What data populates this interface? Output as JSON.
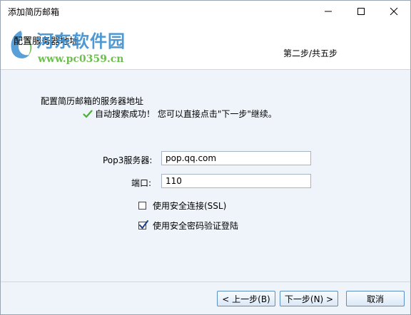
{
  "window": {
    "title": "添加简历邮箱"
  },
  "header": {
    "subtitle": "配置服务器地址",
    "step": "第二步/共五步"
  },
  "watermark": {
    "name": "河东软件园",
    "url": "www.pc0359.cn"
  },
  "main": {
    "heading": "配置简历邮箱的服务器地址",
    "success": "自动搜索成功！ 您可以直接点击\"下一步\"继续。",
    "pop3_label": "Pop3服务器:",
    "pop3_value": "pop.qq.com",
    "port_label": "端口:",
    "port_value": "110",
    "ssl_label": "使用安全连接(SSL)",
    "ssl_checked": false,
    "secure_login_label": "使用安全密码验证登陆",
    "secure_login_checked": true
  },
  "footer": {
    "prev_label": "< 上一步(B)",
    "next_label": "下一步(N) >",
    "cancel_label": "取消"
  },
  "colors": {
    "accent": "#5b8fc5",
    "success_check": "#4caf3a"
  }
}
